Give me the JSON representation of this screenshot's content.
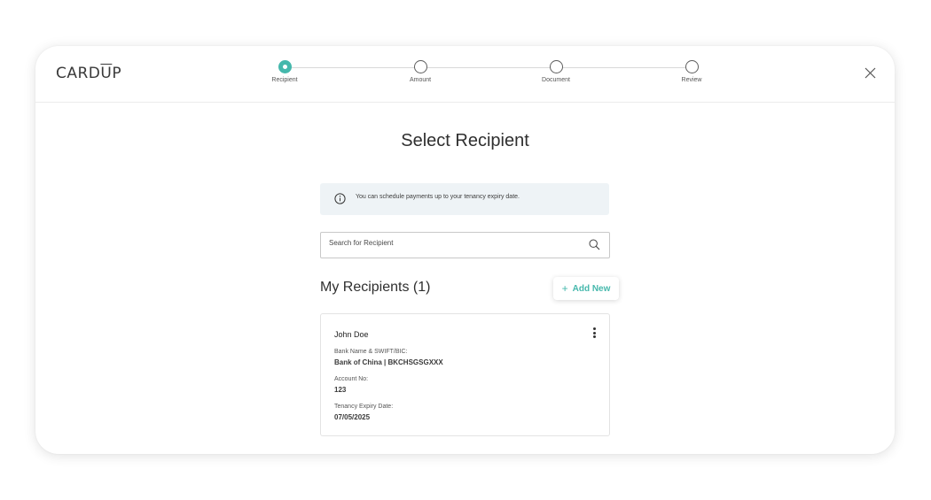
{
  "brand": {
    "logo_text_a": "CARD",
    "logo_text_b": "U",
    "logo_text_c": "P"
  },
  "stepper": {
    "steps": [
      {
        "label": "Recipient",
        "active": true
      },
      {
        "label": "Amount",
        "active": false
      },
      {
        "label": "Document",
        "active": false
      },
      {
        "label": "Review",
        "active": false
      }
    ]
  },
  "page": {
    "title": "Select Recipient"
  },
  "info": {
    "text": "You can schedule payments up to your tenancy expiry date.",
    "icon": "info-icon"
  },
  "search": {
    "placeholder": "Search for Recipient",
    "value": "",
    "icon": "search-icon"
  },
  "recipients": {
    "heading": "My Recipients (1)",
    "add_new_plus": "+",
    "add_new_label": "Add New",
    "items": [
      {
        "name": "John Doe",
        "bank_label": "Bank Name & SWIFT/BIC:",
        "bank_value": "Bank of China | BKCHSGSGXXX",
        "account_label": "Account No:",
        "account_value": "123",
        "expiry_label": "Tenancy Expiry Date:",
        "expiry_value": "07/05/2025"
      }
    ]
  },
  "colors": {
    "accent": "#45b8ac",
    "info_bg": "#eef3f6"
  }
}
